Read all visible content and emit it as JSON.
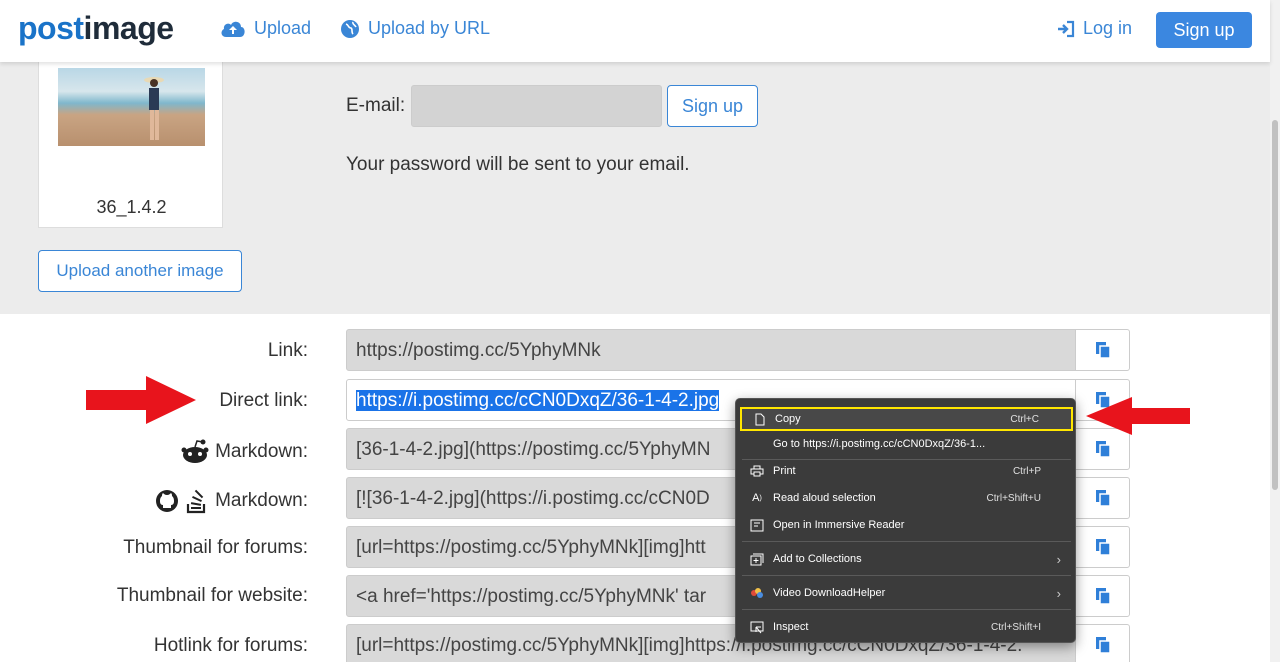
{
  "header": {
    "logo_part1": "post",
    "logo_part2": "image",
    "upload_label": "Upload",
    "upload_url_label": "Upload by URL",
    "login_label": "Log in",
    "signup_label": "Sign up"
  },
  "image_card": {
    "label": "36_1.4.2"
  },
  "upload_another_label": "Upload another image",
  "signup_form": {
    "email_label": "E-mail:",
    "email_value": "",
    "signup_button": "Sign up",
    "password_note": "Your password will be sent to your email."
  },
  "link_rows": [
    {
      "label": "Link:",
      "value": "https://postimg.cc/5YphyMNk"
    },
    {
      "label": "Direct link:",
      "value": "https://i.postimg.cc/cCN0DxqZ/36-1-4-2.jpg"
    },
    {
      "label": "Markdown:",
      "value": "[36-1-4-2.jpg](https://postimg.cc/5YphyMN"
    },
    {
      "label": "Markdown:",
      "value": "[![36-1-4-2.jpg](https://i.postimg.cc/cCN0D"
    },
    {
      "label": "Thumbnail for forums:",
      "value": "[url=https://postimg.cc/5YphyMNk][img]htt"
    },
    {
      "label": "Thumbnail for website:",
      "value": "<a href='https://postimg.cc/5YphyMNk' tar"
    },
    {
      "label": "Hotlink for forums:",
      "value": "[url=https://postimg.cc/5YphyMNk][img]https://i.postimg.cc/cCN0DxqZ/36-1-4-2."
    }
  ],
  "context_menu": {
    "items": [
      {
        "label": "Copy",
        "shortcut": "Ctrl+C",
        "icon": "copy-icon"
      },
      {
        "label": "Go to https://i.postimg.cc/cCN0DxqZ/36-1...",
        "shortcut": "",
        "icon": ""
      },
      {
        "label": "Print",
        "shortcut": "Ctrl+P",
        "icon": "print-icon"
      },
      {
        "label": "Read aloud selection",
        "shortcut": "Ctrl+Shift+U",
        "icon": "read-aloud-icon"
      },
      {
        "label": "Open in Immersive Reader",
        "shortcut": "",
        "icon": "immersive-reader-icon"
      },
      {
        "label": "Add to Collections",
        "shortcut": "",
        "icon": "collections-icon"
      },
      {
        "label": "Video DownloadHelper",
        "shortcut": "",
        "icon": "video-downloadhelper-icon"
      },
      {
        "label": "Inspect",
        "shortcut": "Ctrl+Shift+I",
        "icon": "inspect-icon"
      }
    ]
  },
  "colors": {
    "accent": "#3b87e0",
    "highlight_box": "#ffe600",
    "arrow": "#e8141c",
    "selection": "#1a73e8"
  }
}
